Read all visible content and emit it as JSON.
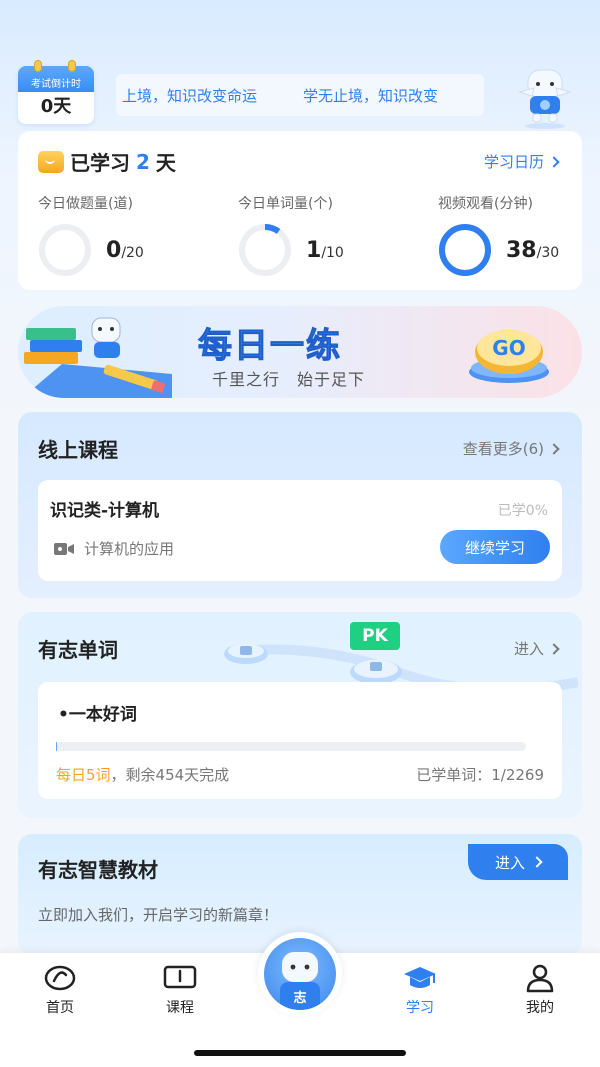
{
  "header": {
    "countdown_label": "考试倒计时",
    "countdown_days": "0天",
    "marquee_text_1": "上境，知识改变命运",
    "marquee_text_2": "学无止境，知识改变"
  },
  "stats": {
    "prefix": "已学习",
    "days": "2",
    "suffix": "天",
    "calendar_link": "学习日历",
    "items": [
      {
        "label": "今日做题量(道)",
        "value": "0",
        "target": "/20",
        "progress": 0.0
      },
      {
        "label": "今日单词量(个)",
        "value": "1",
        "target": "/10",
        "progress": 0.1
      },
      {
        "label": "视频观看(分钟)",
        "value": "38",
        "target": "/30",
        "progress": 1.0
      }
    ]
  },
  "banner": {
    "title": "每日一练",
    "subtitle": "千里之行　始于足下",
    "go_label": "GO"
  },
  "courses": {
    "title": "线上课程",
    "more": "查看更多(6)",
    "course_title": "识记类-计算机",
    "progress": "已学0%",
    "lesson": "计算机的应用",
    "continue": "继续学习"
  },
  "words": {
    "title": "有志单词",
    "enter": "进入",
    "pk": "PK",
    "book": "•一本好词",
    "plan_highlight": "每日5词",
    "plan_rest": "，剩余454天完成",
    "learned": "已学单词：1/2269",
    "progress": 0.0004
  },
  "textbook": {
    "title": "有志智慧教材",
    "enter": "进入",
    "desc": "立即加入我们，开启学习的新篇章！"
  },
  "tabbar": {
    "home": "首页",
    "course": "课程",
    "study": "学习",
    "mine": "我的",
    "fab_badge": "志"
  },
  "colors": {
    "accent": "#2f7fef",
    "ring_track": "#eceef2",
    "highlight": "#f5a623",
    "pk_green": "#1fcf82"
  }
}
